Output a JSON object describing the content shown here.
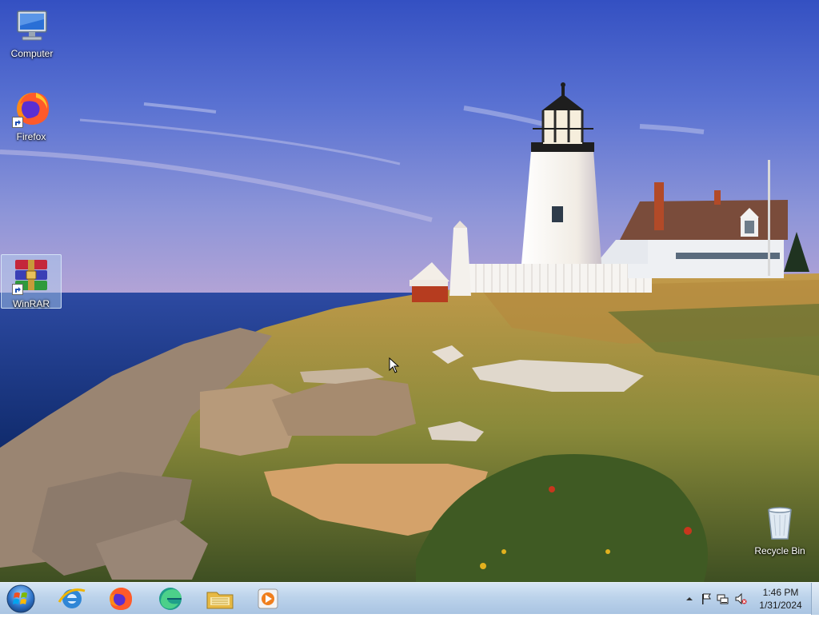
{
  "desktop": {
    "icons": [
      {
        "name": "computer",
        "label": "Computer"
      },
      {
        "name": "firefox",
        "label": "Firefox"
      },
      {
        "name": "winrar",
        "label": "WinRAR",
        "selected": true
      },
      {
        "name": "recycle-bin",
        "label": "Recycle Bin"
      }
    ]
  },
  "taskbar": {
    "pinned": [
      {
        "name": "internet-explorer-icon"
      },
      {
        "name": "firefox-icon"
      },
      {
        "name": "edge-icon"
      },
      {
        "name": "file-explorer-icon"
      },
      {
        "name": "media-player-icon"
      }
    ],
    "tray": {
      "icons": [
        "show-hidden-icons-icon",
        "action-center-flag-icon",
        "network-icon",
        "volume-muted-icon"
      ]
    },
    "clock": {
      "time": "1:46 PM",
      "date": "1/31/2024"
    }
  },
  "colors": {
    "sky_top": "#3a55c4",
    "sea": "#1f3f8f",
    "taskbar": "#bcd3eb"
  }
}
